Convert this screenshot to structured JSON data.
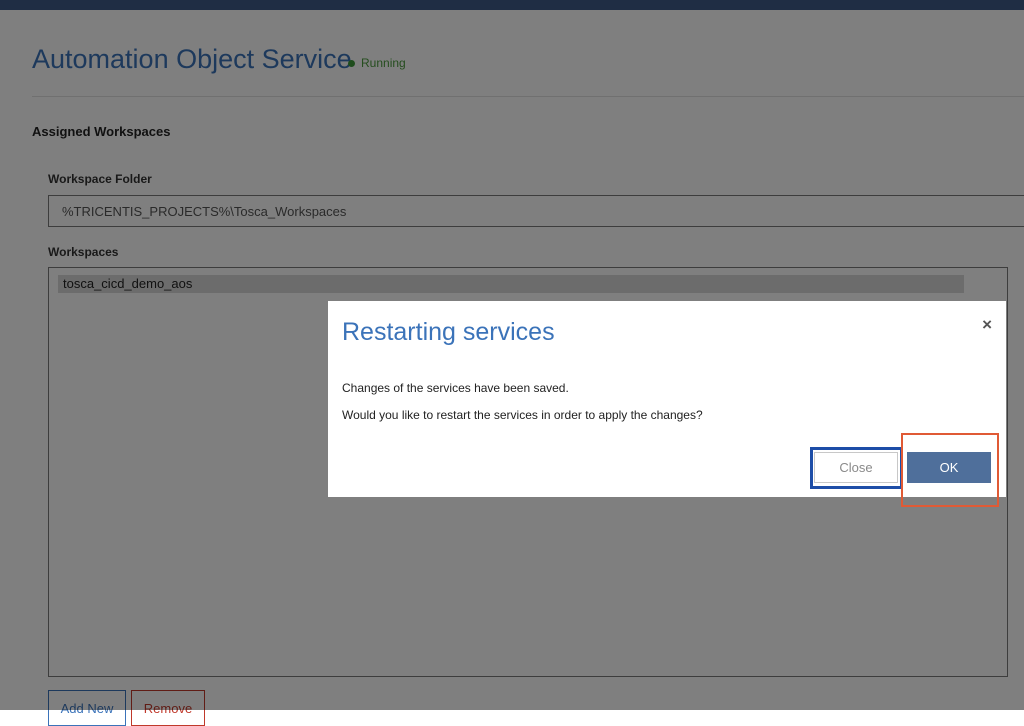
{
  "page": {
    "title": "Automation Object Service",
    "status": "Running"
  },
  "assigned_workspaces": {
    "heading": "Assigned Workspaces",
    "folder_label": "Workspace Folder",
    "folder_value": "%TRICENTIS_PROJECTS%\\Tosca_Workspaces",
    "workspaces_label": "Workspaces",
    "workspaces": [
      "tosca_cicd_demo_aos"
    ]
  },
  "actions": {
    "add_new": "Add New",
    "remove": "Remove"
  },
  "dialog": {
    "title": "Restarting services",
    "close_glyph": "×",
    "line1": "Changes of the services have been saved.",
    "line2": "Would you like to restart the services in order to apply the changes?",
    "close_label": "Close",
    "ok_label": "OK"
  },
  "colors": {
    "accent": "#3b73b9",
    "status_green": "#4a9a3c",
    "ok_button": "#4f6f9b",
    "highlight_blue": "#1d4da7",
    "highlight_orange": "#e05a35"
  },
  "icons": {
    "status": "status-dot-icon",
    "dialog_close": "close-icon"
  }
}
